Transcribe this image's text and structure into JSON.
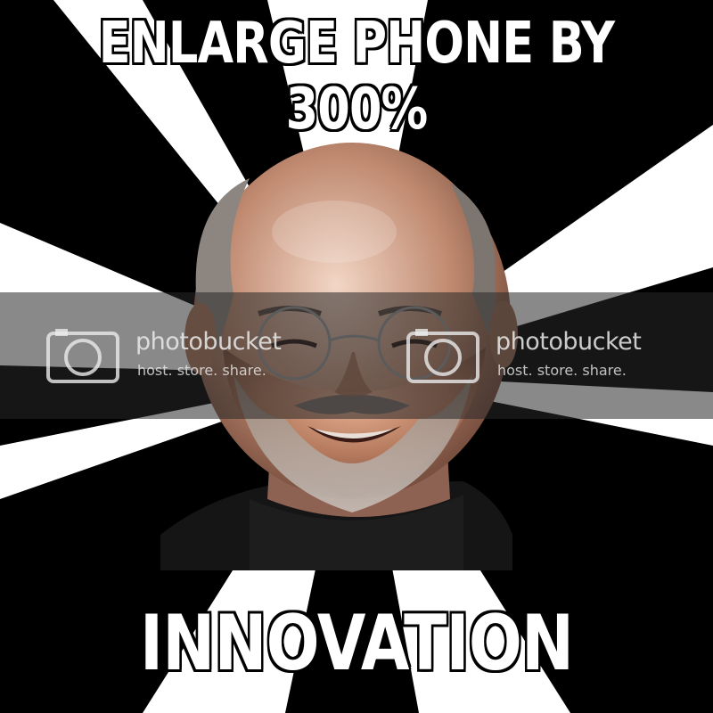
{
  "meme": {
    "top_caption": [
      "ENLARGE PHONE BY",
      "300%"
    ],
    "bottom_caption": "INNOVATION",
    "background": "black-and-white sunburst",
    "colors": {
      "caption_text": "#ffffff",
      "caption_outline": "#000000",
      "ray_light": "#ffffff",
      "ray_dark": "#000000"
    }
  },
  "watermark": {
    "brand": "photobucket",
    "tagline": "host. store. share.",
    "icon": "camera-icon"
  }
}
